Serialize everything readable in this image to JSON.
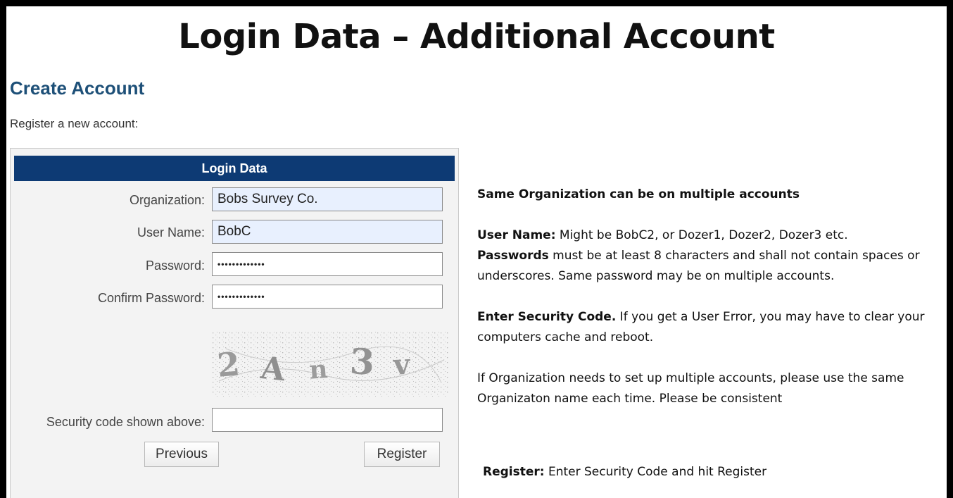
{
  "slide": {
    "title": "Login Data – Additional Account"
  },
  "page": {
    "heading": "Create Account",
    "intro": "Register a new account:"
  },
  "form": {
    "header": "Login Data",
    "organization": {
      "label": "Organization:",
      "value": "Bobs Survey Co."
    },
    "username": {
      "label": "User Name:",
      "value": "BobC"
    },
    "password": {
      "label": "Password:",
      "value": "•••••••••••••"
    },
    "confirm_password": {
      "label": "Confirm Password:",
      "value": "•••••••••••••"
    },
    "captcha": {
      "chars": [
        "2",
        "A",
        "n",
        "3",
        "v"
      ]
    },
    "security_code": {
      "label": "Security code shown above:",
      "value": ""
    },
    "previous_label": "Previous",
    "register_label": "Register"
  },
  "notes": {
    "org_note": "Same Organization can be on multiple accounts",
    "username_bold": "User Name:",
    "username_text": " Might be BobC2, or Dozer1, Dozer2, Dozer3 etc.",
    "password_bold": "Passwords",
    "password_text": " must be at least 8 characters and shall not contain spaces or underscores. Same password may be on multiple accounts.",
    "security_bold": "Enter Security Code.",
    "security_text": "  If you get a User Error, you may have to clear your computers cache and reboot.",
    "multi_text": "If Organization needs to set up multiple accounts, please use the same Organizaton name each time.  Please be consistent",
    "register_bold": "Register:",
    "register_text": "  Enter Security Code and hit Register"
  }
}
